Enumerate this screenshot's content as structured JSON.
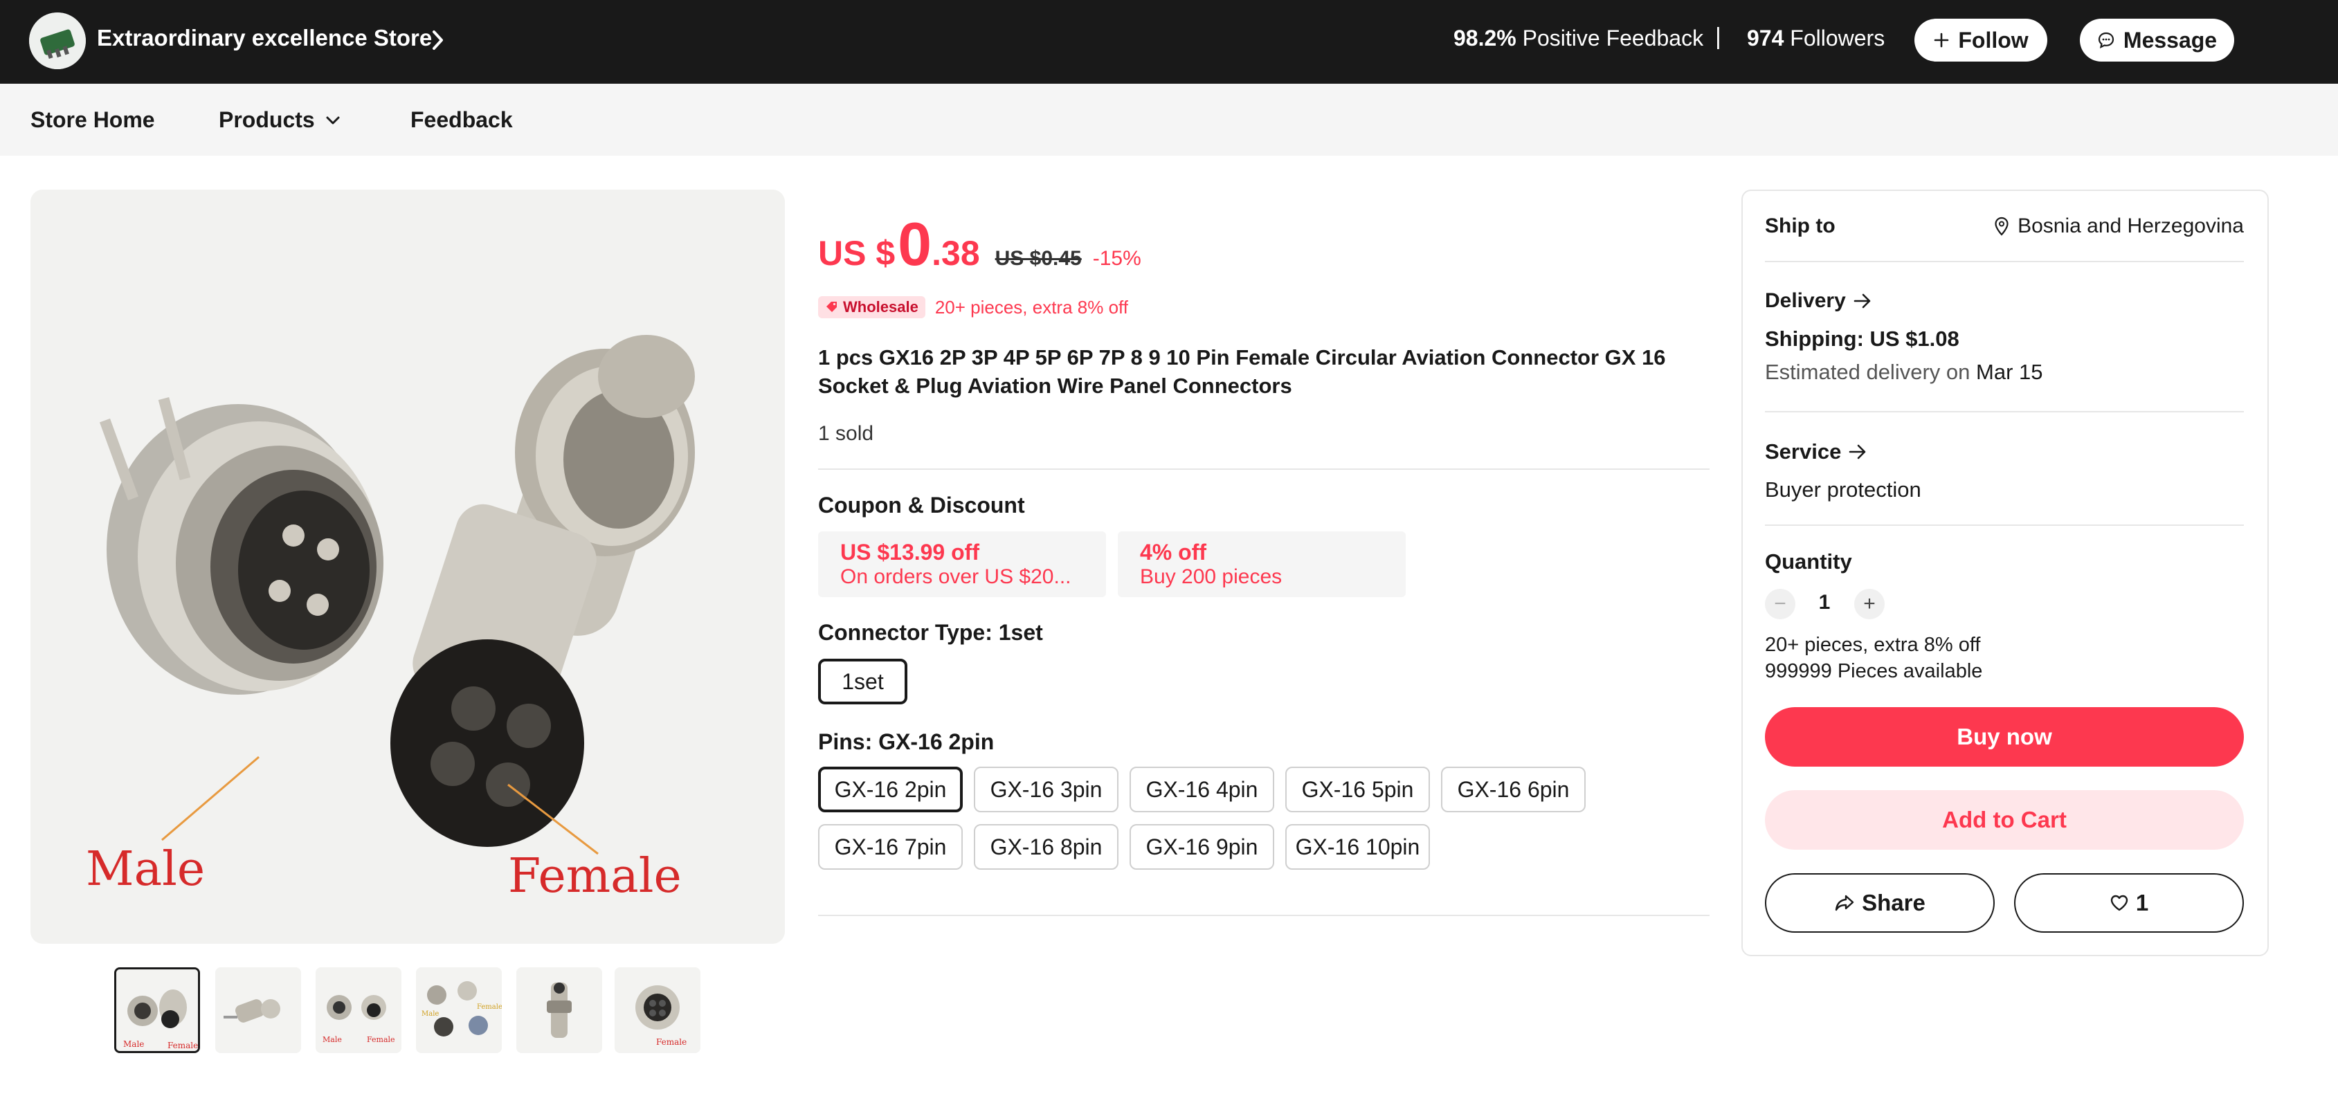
{
  "store": {
    "name": "Extraordinary excellence Store",
    "feedback_value": "98.2%",
    "feedback_label": "Positive Feedback",
    "separator": "|",
    "followers_value": "974",
    "followers_label": "Followers",
    "follow_label": "Follow",
    "message_label": "Message"
  },
  "nav": {
    "home": "Store Home",
    "products": "Products",
    "feedback": "Feedback"
  },
  "product": {
    "price_currency": "US $",
    "price_int": "0",
    "price_dec": ".38",
    "price_old": "US $0.45",
    "discount": "-15%",
    "wholesale_badge": "Wholesale",
    "wholesale_text": "20+ pieces, extra 8% off",
    "title": "1 pcs GX16 2P 3P 4P 5P 6P 7P 8 9 10 Pin Female Circular Aviation Connector GX 16 Socket & Plug Aviation Wire Panel Connectors",
    "sold": "1 sold",
    "image_labels": {
      "male": "Male",
      "female": "Female"
    }
  },
  "coupons": {
    "heading": "Coupon & Discount",
    "items": [
      {
        "title": "US $13.99 off",
        "subtitle": "On orders over US $20..."
      },
      {
        "title": "4% off",
        "subtitle": "Buy 200 pieces"
      }
    ]
  },
  "options": {
    "connector_label": "Connector Type: 1set",
    "connector_values": [
      "1set"
    ],
    "pins_label": "Pins: GX-16 2pin",
    "pins_values": [
      "GX-16 2pin",
      "GX-16 3pin",
      "GX-16 4pin",
      "GX-16 5pin",
      "GX-16 6pin",
      "GX-16 7pin",
      "GX-16 8pin",
      "GX-16 9pin",
      "GX-16 10pin"
    ]
  },
  "panel": {
    "ship_to_label": "Ship to",
    "ship_to_value": "Bosnia and Herzegovina",
    "delivery_title": "Delivery",
    "shipping_cost": "Shipping: US $1.08",
    "est_prefix": "Estimated delivery on",
    "est_date": "Mar 15",
    "service_title": "Service",
    "service_value": "Buyer protection",
    "quantity_label": "Quantity",
    "quantity_value": "1",
    "qty_minus": "−",
    "qty_plus": "+",
    "qty_note": "20+ pieces, extra 8% off",
    "available": "999999 Pieces available",
    "buy_now": "Buy now",
    "add_to_cart": "Add to Cart",
    "share": "Share",
    "wishlist_count": "1"
  },
  "colors": {
    "topbar": "#191919",
    "accent": "#fd384f",
    "accent_light": "#ffe6e9",
    "nav_bg": "#f5f5f5"
  }
}
